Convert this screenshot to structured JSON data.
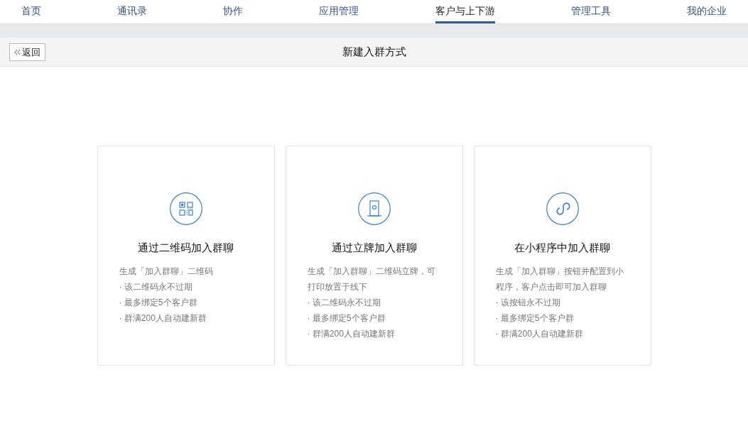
{
  "nav_tabs": [
    {
      "label": "首页",
      "selected": false
    },
    {
      "label": "通讯录",
      "selected": false
    },
    {
      "label": "协作",
      "selected": false
    },
    {
      "label": "应用管理",
      "selected": false
    },
    {
      "label": "客户与上下游",
      "selected": true
    },
    {
      "label": "管理工具",
      "selected": false
    },
    {
      "label": "我的企业",
      "selected": false
    }
  ],
  "header": {
    "back_button": "返回",
    "title": "新建入群方式"
  },
  "cards": [
    {
      "kind": "qrcode",
      "title": "通过二维码加入群聊",
      "description": "生成「加入群聊」二维码",
      "points": [
        "· 该二维码永不过期",
        "· 最多绑定5个客户群",
        "· 群满200人自动建新群"
      ]
    },
    {
      "kind": "stand",
      "title": "通过立牌加入群聊",
      "description": "生成「加入群聊」二维码立牌，可打印放置于线下",
      "points": [
        "· 该二维码永不过期",
        "· 最多绑定5个客户群",
        "· 群满200人自动建新群"
      ]
    },
    {
      "kind": "miniprogram",
      "title": "在小程序中加入群聊",
      "description": "生成「加入群聊」按钮并配置到小程序，客户点击即可加入群聊",
      "points": [
        "· 该按钮永不过期",
        "· 最多绑定5个客户群",
        "· 群满200人自动建新群"
      ]
    }
  ]
}
